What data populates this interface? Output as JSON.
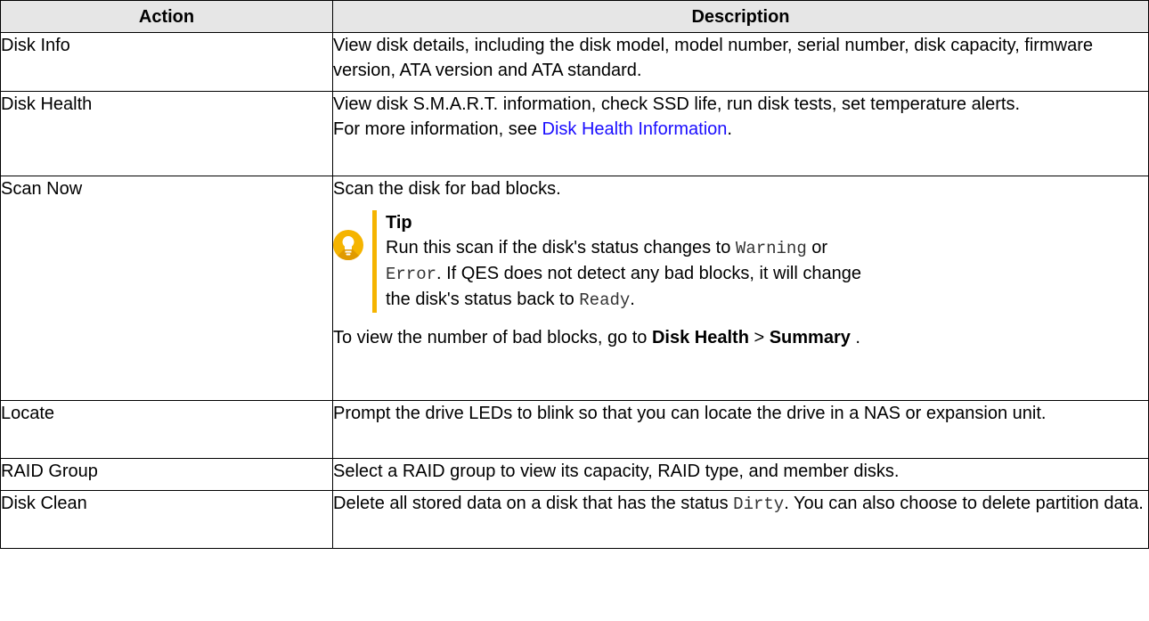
{
  "headers": {
    "action": "Action",
    "description": "Description"
  },
  "rows": {
    "disk_info": {
      "action": "Disk Info",
      "desc": "View disk details, including the disk model, model number, serial number, disk capacity, firmware version, ATA version and ATA standard."
    },
    "disk_health": {
      "action": "Disk Health",
      "desc_line1": "View disk S.M.A.R.T. information, check SSD life, run disk tests, set temperature alerts.",
      "desc_prefix": "For more information, see ",
      "link": "Disk Health Information",
      "desc_suffix": "."
    },
    "scan_now": {
      "action": "Scan Now",
      "desc_line1": "Scan the disk for bad blocks.",
      "tip_title": "Tip",
      "tip_t1": "Run this scan if the disk's status changes to ",
      "tip_code1": "Warning",
      "tip_t2": " or ",
      "tip_code2": "Error",
      "tip_t3": ". If QES does not detect any bad blocks, it will change the disk's status back to ",
      "tip_code3": "Ready",
      "tip_t4": ".",
      "after_prefix": "To view the number of bad blocks, go to ",
      "after_b1": "Disk Health",
      "after_sep": " > ",
      "after_b2": "Summary",
      "after_suffix": " ."
    },
    "locate": {
      "action": "Locate",
      "desc": "Prompt the drive LEDs to blink so that you can locate the drive in a NAS or expansion unit."
    },
    "raid_group": {
      "action": "RAID Group",
      "desc": "Select a RAID group to view its capacity, RAID type, and member disks."
    },
    "disk_clean": {
      "action": "Disk Clean",
      "desc_t1": "Delete all stored data on a disk that has the status ",
      "desc_code": "Dirty",
      "desc_t2": ". You can also choose to delete partition data."
    }
  },
  "icons": {
    "tip": "lightbulb-icon"
  },
  "colors": {
    "header_bg": "#e6e6e6",
    "tip_accent": "#f5b400",
    "link": "#1a0dff"
  }
}
